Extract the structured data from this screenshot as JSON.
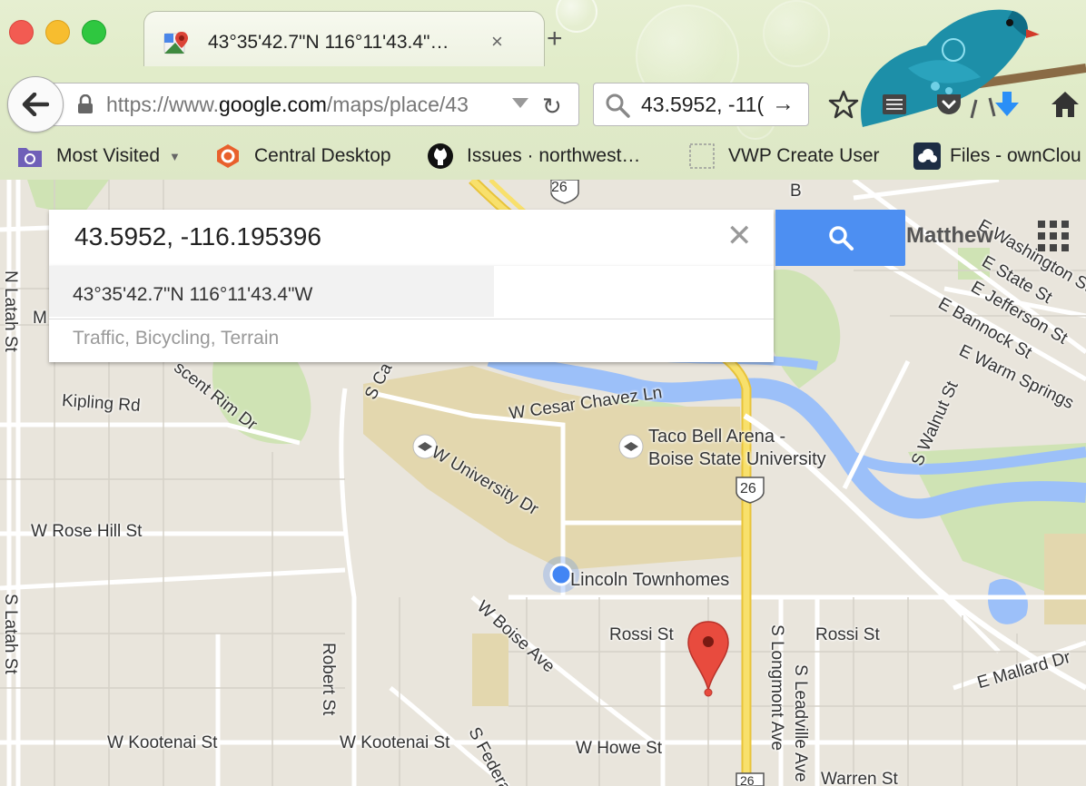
{
  "tab": {
    "title": "43°35'42.7\"N 116°11'43.4\"…",
    "close": "×",
    "new_tab": "+"
  },
  "navbar": {
    "url_prefix": "https://www.",
    "url_domain": "google.com",
    "url_path": "/maps/place/43",
    "search_value": "43.5952, -11("
  },
  "bookmarks": [
    {
      "label": "Most Visited",
      "icon": "folder-gear-icon"
    },
    {
      "label": "Central Desktop",
      "icon": "central-desktop-icon"
    },
    {
      "label": "Issues · northwest…",
      "icon": "github-icon"
    },
    {
      "label": "VWP Create User",
      "icon": "blank-page-icon"
    },
    {
      "label": "Files - ownClou",
      "icon": "owncloud-icon"
    }
  ],
  "maps": {
    "search_value": "43.5952, -116.195396",
    "user_name": "Matthew",
    "suggestions": [
      "43°35'42.7\"N 116°11'43.4\"W",
      "Traffic, Bicycling, Terrain"
    ]
  },
  "map_labels": {
    "kipling": "Kipling Rd",
    "scent_rim": "scent Rim Dr",
    "rose_hill": "W Rose Hill St",
    "cesar_chavez": "W Cesar Chavez Ln",
    "university": "W University Dr",
    "taco_bell_1": "Taco Bell Arena -",
    "taco_bell_2": "Boise State University",
    "lincoln": "Lincoln Townhomes",
    "rossi_1": "Rossi St",
    "rossi_2": "Rossi St",
    "boise_ave": "W Boise Ave",
    "robert": "Robert St",
    "kootenai_1": "W Kootenai St",
    "kootenai_2": "W Kootenai St",
    "howe": "W Howe St",
    "federal": "S Federa",
    "longmont": "S Longmont Ave",
    "leadville": "S Leadville Ave",
    "warren": "Warren St",
    "mallard": "E Mallard Dr",
    "walnut": "S Walnut St",
    "warm_springs": "E Warm Springs",
    "bannock": "E Bannock St",
    "jefferson": "E Jefferson St",
    "state": "E State St",
    "washington": "E Washington St",
    "latah_n": "N Latah St",
    "latah_s": "S Latah St",
    "capitol": "S Ca",
    "m_letter": "M",
    "b_letter": "B",
    "hwy_26_top": "26",
    "hwy_26_mid": "26",
    "hwy_26_bot": "26"
  }
}
